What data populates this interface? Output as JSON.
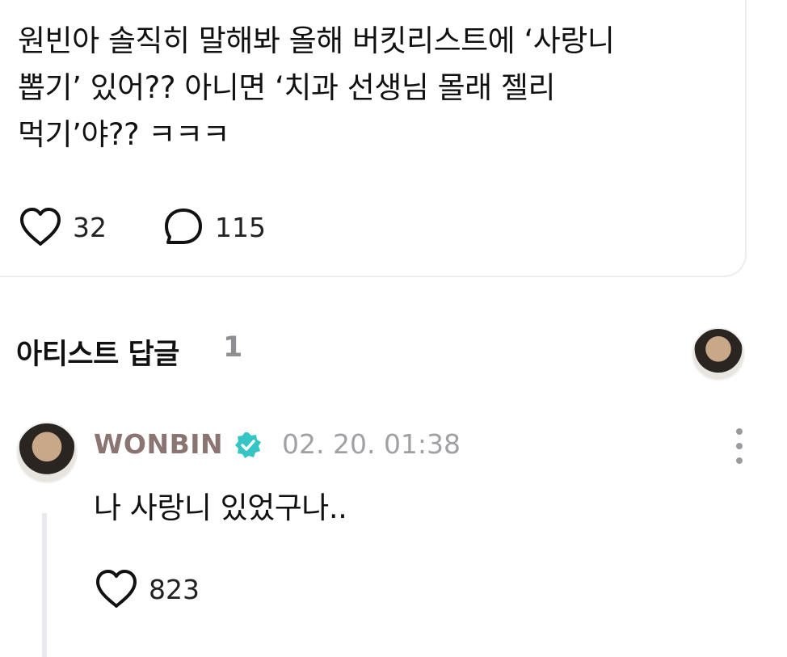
{
  "post": {
    "text": "원빈아 솔직히 말해봐 올해 버킷리스트에 ‘사랑니\n뽑기’ 있어?? 아니면 ‘치과 선생님 몰래 젤리\n먹기’야?? ㅋㅋㅋ",
    "like_count": "32",
    "comment_count": "115"
  },
  "section": {
    "title": "아티스트 답글",
    "count": "1"
  },
  "reply": {
    "author": "WONBIN",
    "timestamp": "02. 20. 01:38",
    "text": "나 사랑니 있었구나..",
    "like_count": "823"
  },
  "icons": {
    "like": "heart-outline-icon",
    "comment": "speech-bubble-icon",
    "verified": "verified-badge-icon",
    "more": "more-vertical-icon"
  },
  "colors": {
    "author_name": "#8a7572",
    "verified_badge": "#35c5c5",
    "timestamp": "#a0a0a5",
    "card_border": "#ececf1"
  }
}
